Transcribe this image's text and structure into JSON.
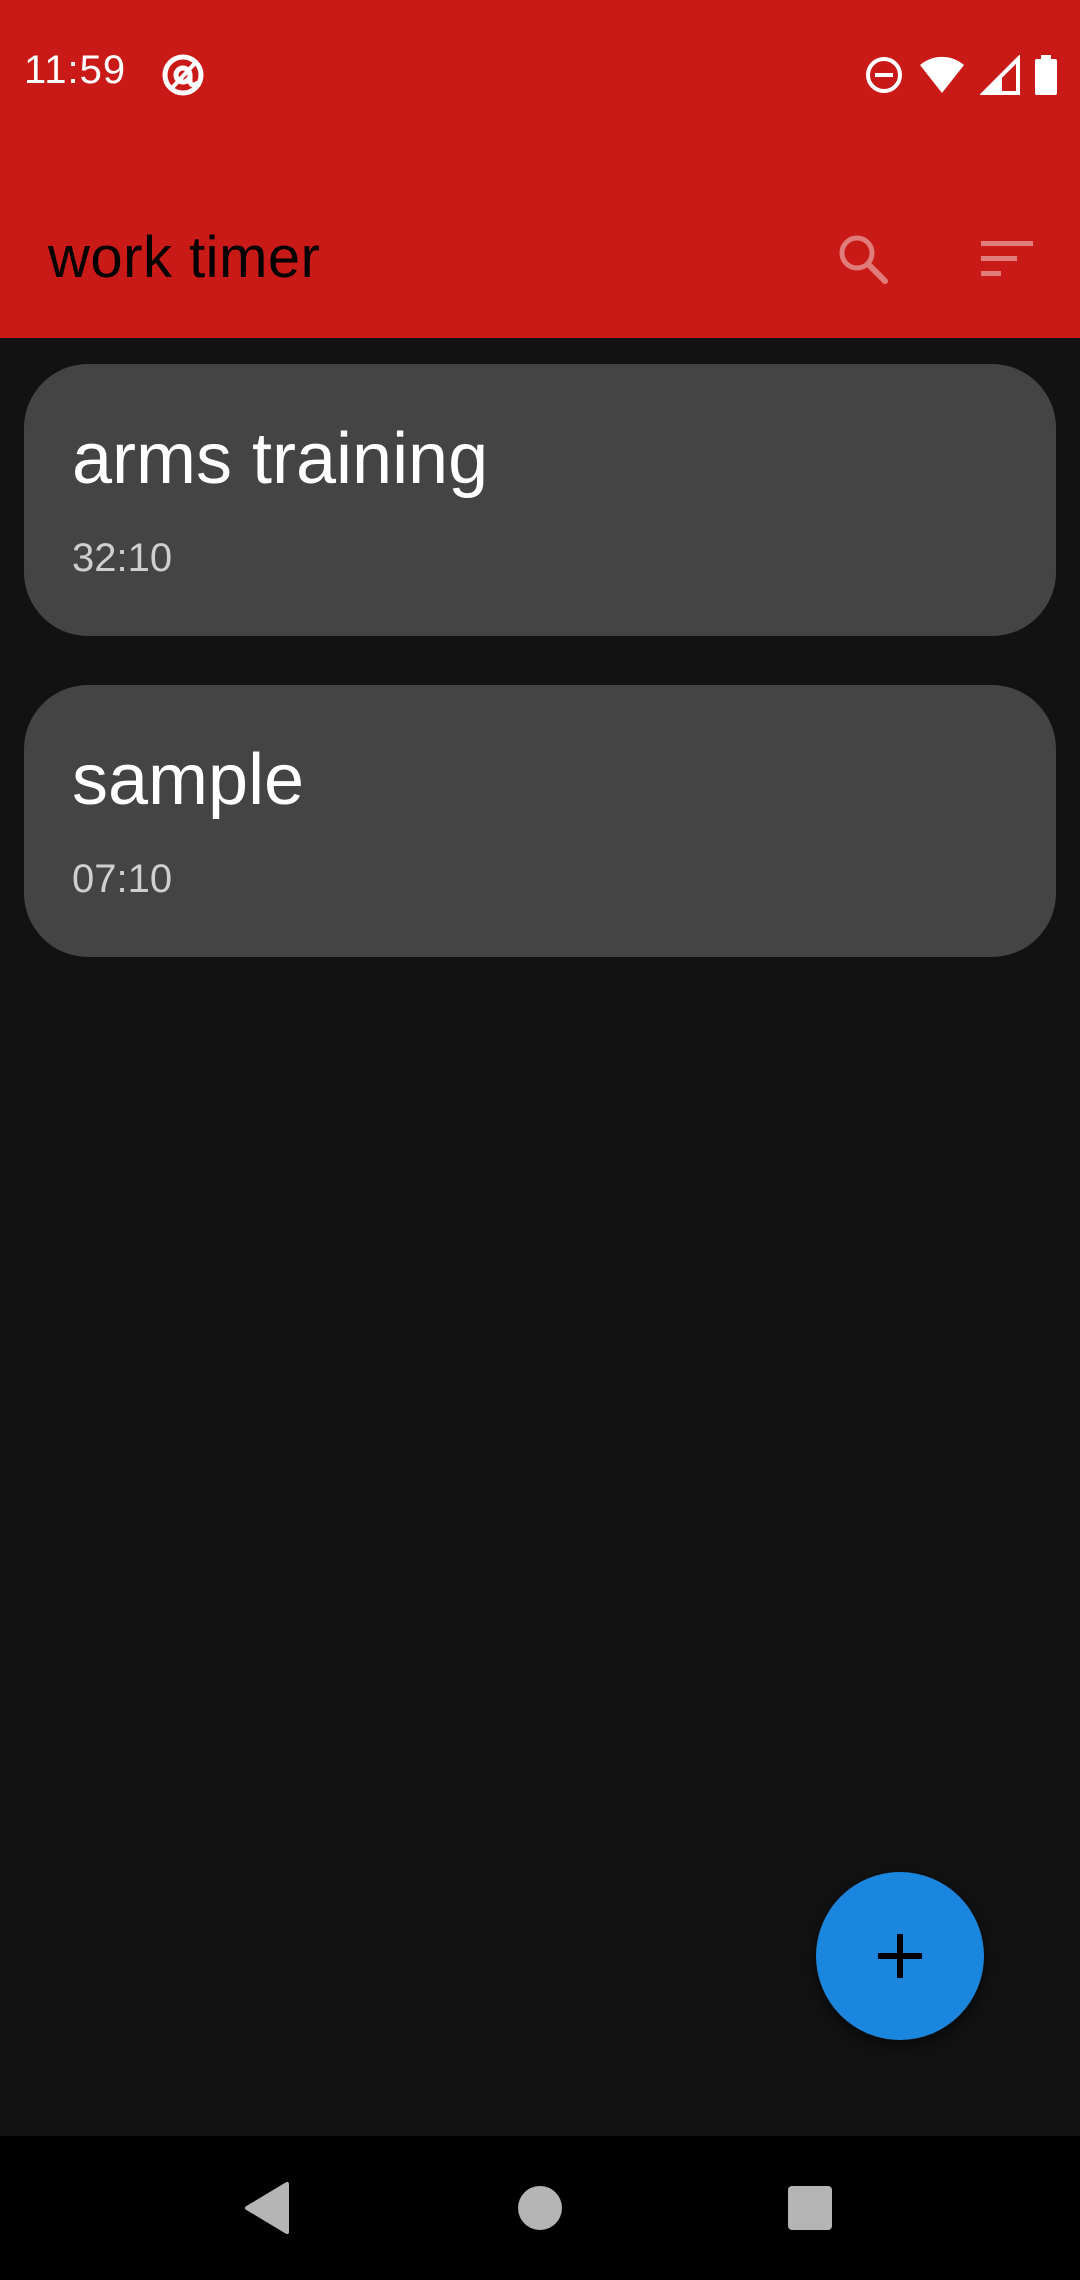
{
  "status_bar": {
    "time": "11:59",
    "icons": [
      "at-sign-icon",
      "do-not-disturb-icon",
      "wifi-icon",
      "cell-signal-icon",
      "battery-icon"
    ]
  },
  "app_bar": {
    "title": "work timer",
    "actions": [
      "search-icon",
      "sort-icon"
    ]
  },
  "timers": [
    {
      "name": "arms training",
      "duration": "32:10"
    },
    {
      "name": "sample",
      "duration": "07:10"
    }
  ],
  "fab": {
    "icon": "plus-icon"
  },
  "nav_bar": {
    "buttons": [
      "back-icon",
      "home-icon",
      "recents-icon"
    ]
  },
  "colors": {
    "app_bar": "#c91a18",
    "background": "#121212",
    "card": "#444444",
    "fab": "#1a86de"
  }
}
